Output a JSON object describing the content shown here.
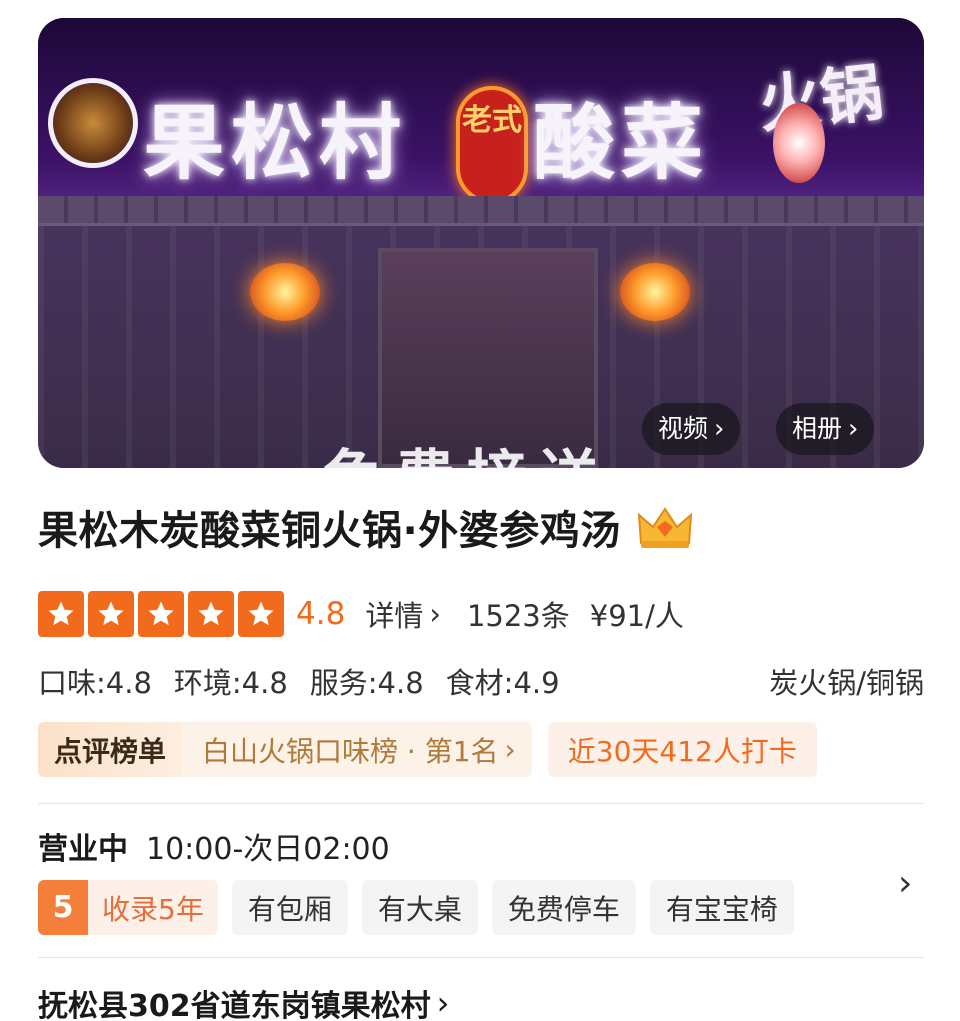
{
  "hero": {
    "sign_left": "果松村",
    "sign_badge": "老式",
    "sign_right": "酸菜",
    "sign_small": "火锅",
    "banner": "免费接送",
    "video_label": "视频",
    "album_label": "相册"
  },
  "shop": {
    "name": "果松木炭酸菜铜火锅·外婆参鸡汤",
    "score": "4.8",
    "stars": 5,
    "detail_label": "详情",
    "reviews": "1523条",
    "price": "¥91/人",
    "subscores": [
      "口味:4.8",
      "环境:4.8",
      "服务:4.8",
      "食材:4.9"
    ],
    "category": "炭火锅/铜锅"
  },
  "ranking": {
    "tag": "点评榜单",
    "text": "白山火锅口味榜 · 第1名",
    "checkin": "近30天412人打卡"
  },
  "hours": {
    "status": "营业中",
    "time": "10:00-次日02:00"
  },
  "tags": {
    "years_num": "5",
    "years_text": "收录5年",
    "items": [
      "有包厢",
      "有大桌",
      "免费停车",
      "有宝宝椅"
    ]
  },
  "address": {
    "text": "抚松县302省道东岗镇果松村"
  },
  "colors": {
    "accent": "#f26b1d",
    "rank_text": "#b07a3a"
  }
}
